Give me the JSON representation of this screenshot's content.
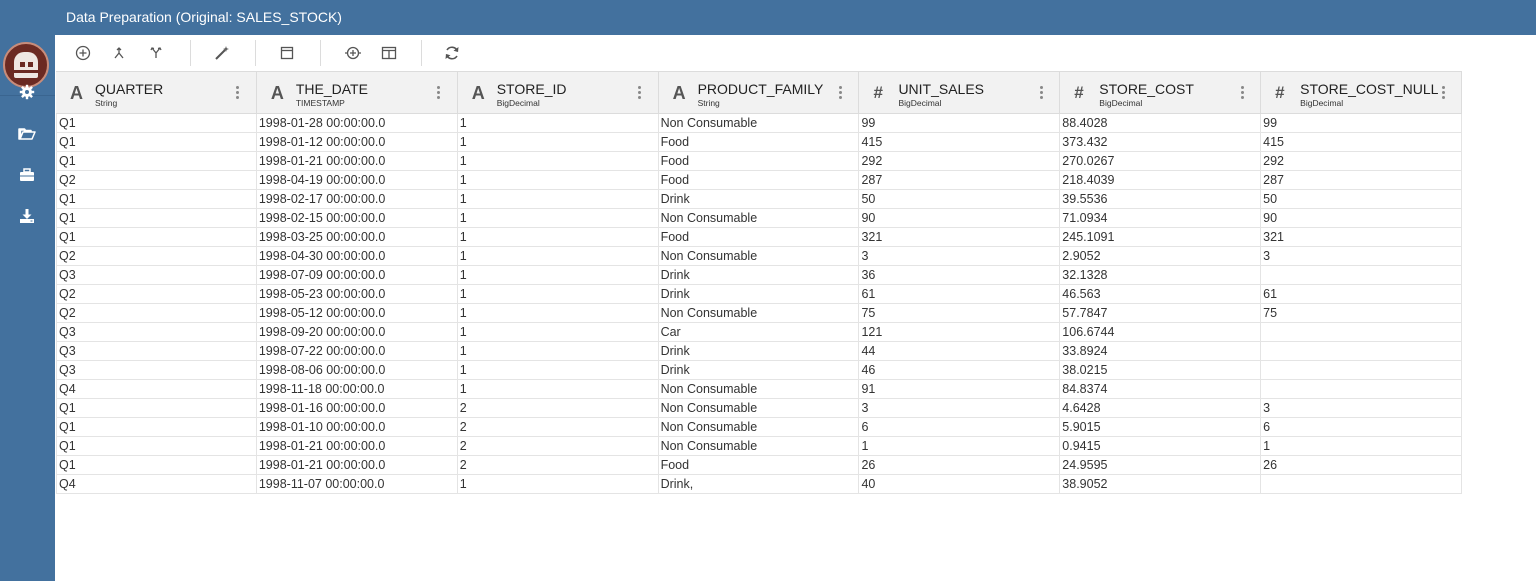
{
  "window": {
    "title": "Data Preparation (Original: SALES_STOCK)"
  },
  "colors": {
    "header_bg": "#43719e",
    "sidebar_bg": "#43719e",
    "grid_header_bg": "#f2f2f2"
  },
  "sidebar": {
    "items": [
      {
        "icon": "gear-icon"
      },
      {
        "icon": "folder-open-icon"
      },
      {
        "icon": "briefcase-icon"
      },
      {
        "icon": "download-icon"
      }
    ]
  },
  "toolbar": {
    "items": [
      {
        "icon": "add-circle-icon"
      },
      {
        "icon": "merge-icon"
      },
      {
        "icon": "split-icon"
      },
      {
        "icon": "magic-wand-icon"
      },
      {
        "icon": "frame-icon"
      },
      {
        "icon": "add-column-icon"
      },
      {
        "icon": "columns-icon"
      },
      {
        "icon": "refresh-icon"
      }
    ]
  },
  "columns": [
    {
      "type_symbol": "A",
      "name": "QUARTER",
      "type": "String"
    },
    {
      "type_symbol": "A",
      "name": "THE_DATE",
      "type": "TIMESTAMP"
    },
    {
      "type_symbol": "A",
      "name": "STORE_ID",
      "type": "BigDecimal"
    },
    {
      "type_symbol": "A",
      "name": "PRODUCT_FAMILY",
      "type": "String"
    },
    {
      "type_symbol": "#",
      "name": "UNIT_SALES",
      "type": "BigDecimal"
    },
    {
      "type_symbol": "#",
      "name": "STORE_COST",
      "type": "BigDecimal"
    },
    {
      "type_symbol": "#",
      "name": "STORE_COST_NULL",
      "type": "BigDecimal"
    }
  ],
  "rows": [
    [
      "Q1",
      "1998-01-28 00:00:00.0",
      "1",
      "Non Consumable",
      "99",
      "88.4028",
      "99"
    ],
    [
      "Q1",
      "1998-01-12 00:00:00.0",
      "1",
      "Food",
      "415",
      "373.432",
      "415"
    ],
    [
      "Q1",
      "1998-01-21 00:00:00.0",
      "1",
      "Food",
      "292",
      "270.0267",
      "292"
    ],
    [
      "Q2",
      "1998-04-19 00:00:00.0",
      "1",
      "Food",
      "287",
      "218.4039",
      "287"
    ],
    [
      "Q1",
      "1998-02-17 00:00:00.0",
      "1",
      "Drink",
      "50",
      "39.5536",
      "50"
    ],
    [
      "Q1",
      "1998-02-15 00:00:00.0",
      "1",
      "Non Consumable",
      "90",
      "71.0934",
      "90"
    ],
    [
      "Q1",
      "1998-03-25 00:00:00.0",
      "1",
      "Food",
      "321",
      "245.1091",
      "321"
    ],
    [
      "Q2",
      "1998-04-30 00:00:00.0",
      "1",
      "Non Consumable",
      "3",
      "2.9052",
      "3"
    ],
    [
      "Q3",
      "1998-07-09 00:00:00.0",
      "1",
      "Drink",
      "36",
      "32.1328",
      ""
    ],
    [
      "Q2",
      "1998-05-23 00:00:00.0",
      "1",
      "Drink",
      "61",
      "46.563",
      "61"
    ],
    [
      "Q2",
      "1998-05-12 00:00:00.0",
      "1",
      "Non Consumable",
      "75",
      "57.7847",
      "75"
    ],
    [
      "Q3",
      "1998-09-20 00:00:00.0",
      "1",
      "Car",
      "121",
      "106.6744",
      ""
    ],
    [
      "Q3",
      "1998-07-22 00:00:00.0",
      "1",
      "Drink",
      "44",
      "33.8924",
      ""
    ],
    [
      "Q3",
      "1998-08-06 00:00:00.0",
      "1",
      "Drink",
      "46",
      "38.0215",
      ""
    ],
    [
      "Q4",
      "1998-11-18 00:00:00.0",
      "1",
      "Non Consumable",
      "91",
      "84.8374",
      ""
    ],
    [
      "Q1",
      "1998-01-16 00:00:00.0",
      "2",
      "Non Consumable",
      "3",
      "4.6428",
      "3"
    ],
    [
      "Q1",
      "1998-01-10 00:00:00.0",
      "2",
      "Non Consumable",
      "6",
      "5.9015",
      "6"
    ],
    [
      "Q1",
      "1998-01-21 00:00:00.0",
      "2",
      "Non Consumable",
      "1",
      "0.9415",
      "1"
    ],
    [
      "Q1",
      "1998-01-21 00:00:00.0",
      "2",
      "Food",
      "26",
      "24.9595",
      "26"
    ],
    [
      "Q4",
      "1998-11-07 00:00:00.0",
      "1",
      "Drink,",
      "40",
      "38.9052",
      ""
    ]
  ]
}
